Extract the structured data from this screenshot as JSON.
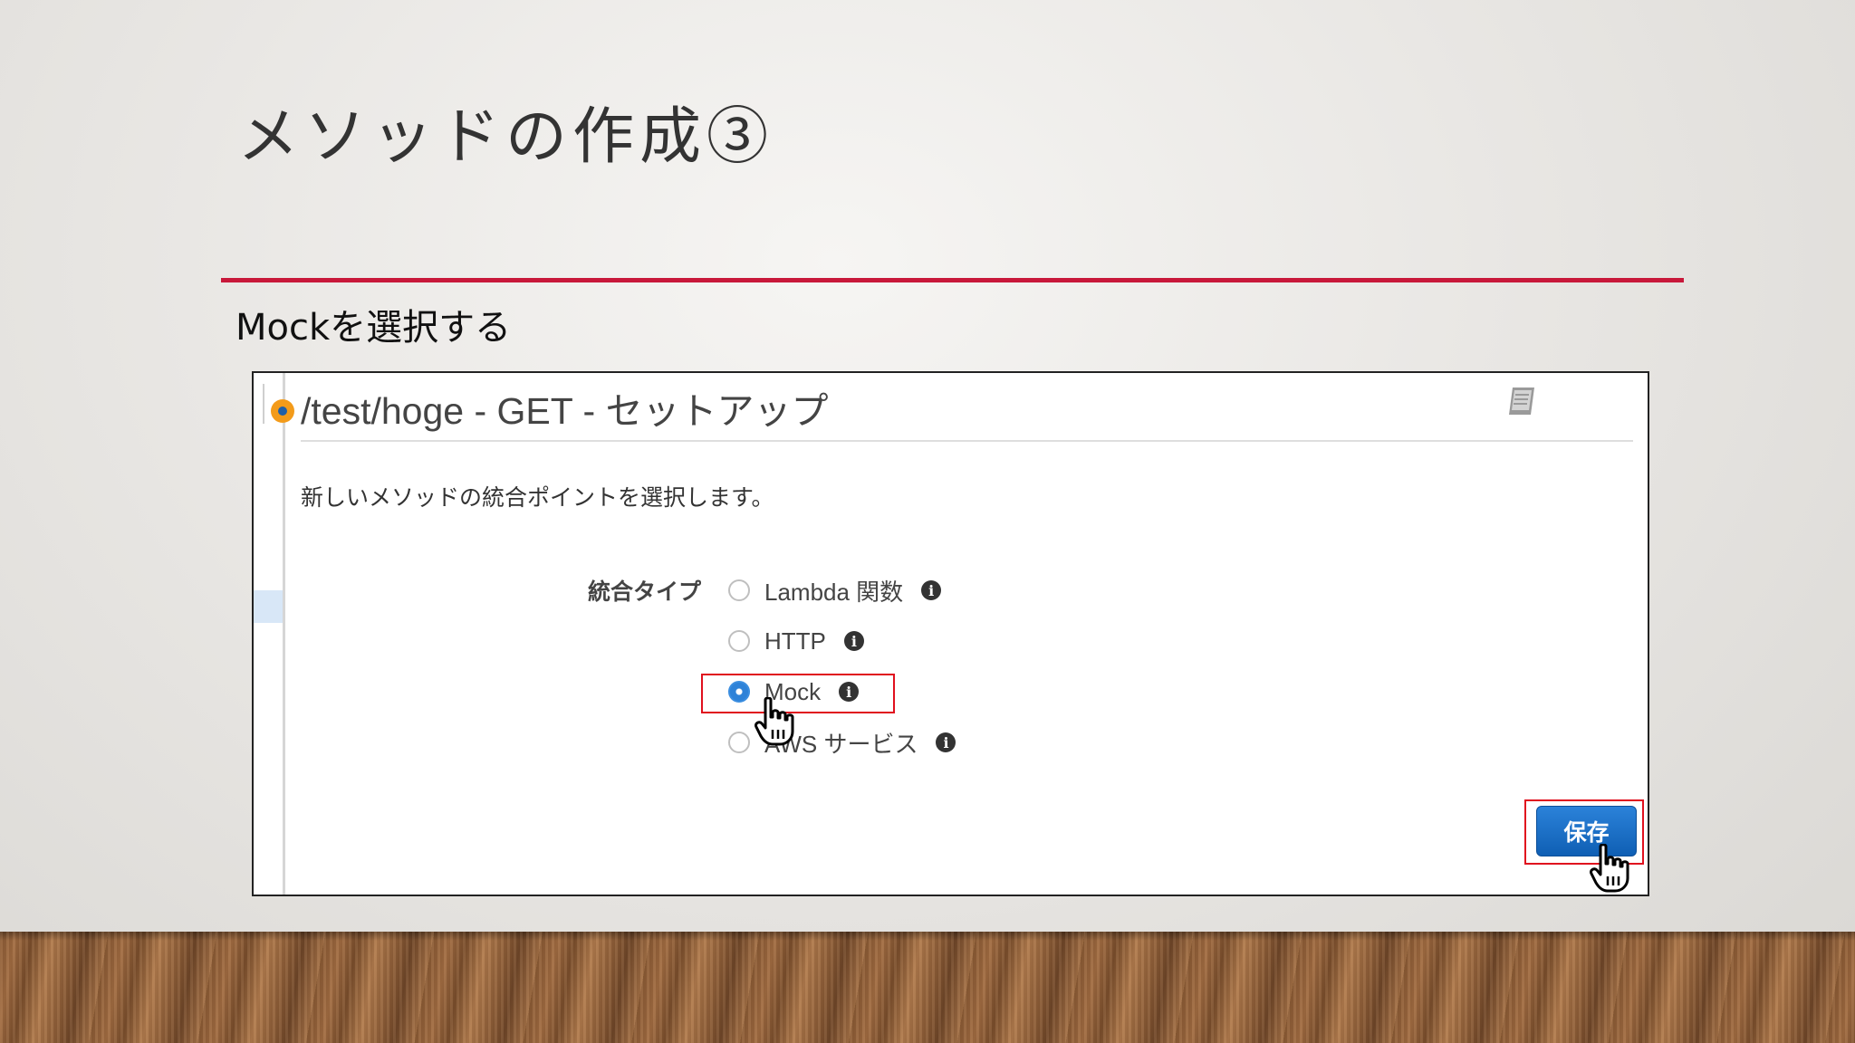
{
  "slide": {
    "title": "メソッドの作成③",
    "subtitle": "Mockを選択する"
  },
  "panel": {
    "title": "/test/hoge - GET - セットアップ",
    "description": "新しいメソッドの統合ポイントを選択します。",
    "integration_label": "統合タイプ",
    "options": [
      {
        "label": "Lambda 関数",
        "selected": false
      },
      {
        "label": "HTTP",
        "selected": false
      },
      {
        "label": "Mock",
        "selected": true
      },
      {
        "label": "AWS サービス",
        "selected": false
      }
    ],
    "save_label": "保存"
  },
  "icons": {
    "status": "status-dot-icon",
    "docs": "book-icon",
    "info": "info-icon",
    "cursor": "hand-pointer-icon"
  },
  "colors": {
    "title_rule": "#c8183a",
    "highlight": "#e0101e",
    "save_button": "#1a6fc6",
    "status_dot": "#f39b1a"
  }
}
